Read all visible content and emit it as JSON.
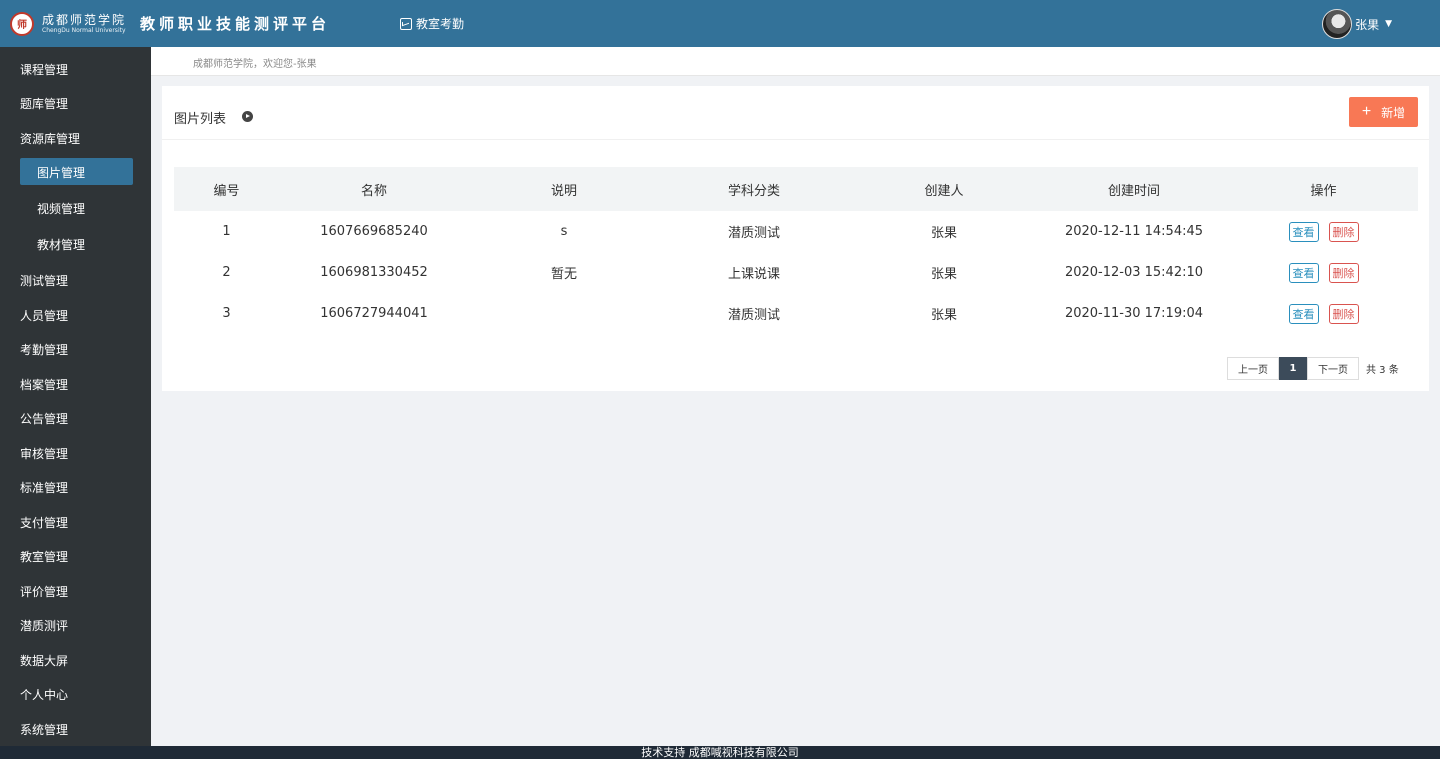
{
  "header": {
    "logo_cn": "成都师范学院",
    "logo_en": "ChengDu Normal University",
    "logo_seal": "师",
    "platform_title": "教师职业技能测评平台",
    "nav_link": "教室考勤",
    "user_name": "张果",
    "caret": "▼"
  },
  "sidebar": {
    "items": [
      {
        "label": "课程管理"
      },
      {
        "label": "题库管理"
      },
      {
        "label": "资源库管理"
      },
      {
        "label": "图片管理"
      },
      {
        "label": "视频管理"
      },
      {
        "label": "教材管理"
      },
      {
        "label": "测试管理"
      },
      {
        "label": "人员管理"
      },
      {
        "label": "考勤管理"
      },
      {
        "label": "档案管理"
      },
      {
        "label": "公告管理"
      },
      {
        "label": "审核管理"
      },
      {
        "label": "标准管理"
      },
      {
        "label": "支付管理"
      },
      {
        "label": "教室管理"
      },
      {
        "label": "评价管理"
      },
      {
        "label": "潜质测评"
      },
      {
        "label": "数据大屏"
      },
      {
        "label": "个人中心"
      },
      {
        "label": "系统管理"
      }
    ]
  },
  "breadcrumb": "成都师范学院，欢迎您-张果",
  "panel": {
    "title": "图片列表",
    "add_plus": "+",
    "add_label": "新增"
  },
  "table": {
    "columns": [
      "编号",
      "名称",
      "说明",
      "学科分类",
      "创建人",
      "创建时间",
      "操作"
    ],
    "rows": [
      {
        "id": "1",
        "name": "1607669685240",
        "desc": "s",
        "category": "潜质测试",
        "creator": "张果",
        "time": "2020-12-11 14:54:45"
      },
      {
        "id": "2",
        "name": "1606981330452",
        "desc": "暂无",
        "category": "上课说课",
        "creator": "张果",
        "time": "2020-12-03 15:42:10"
      },
      {
        "id": "3",
        "name": "1606727944041",
        "desc": "",
        "category": "潜质测试",
        "creator": "张果",
        "time": "2020-11-30 17:19:04"
      }
    ],
    "view_label": "查看",
    "delete_label": "删除"
  },
  "pager": {
    "prev": "上一页",
    "current": "1",
    "next": "下一页",
    "total": "共 3 条"
  },
  "footer": "技术支持 成都喊视科技有限公司",
  "colors": {
    "header_bg": "#337299",
    "sidebar_bg": "#2f3437",
    "active_item": "#337299",
    "add_button": "#f87855",
    "view_button": "#2a8fbd",
    "delete_button": "#d9534f"
  }
}
